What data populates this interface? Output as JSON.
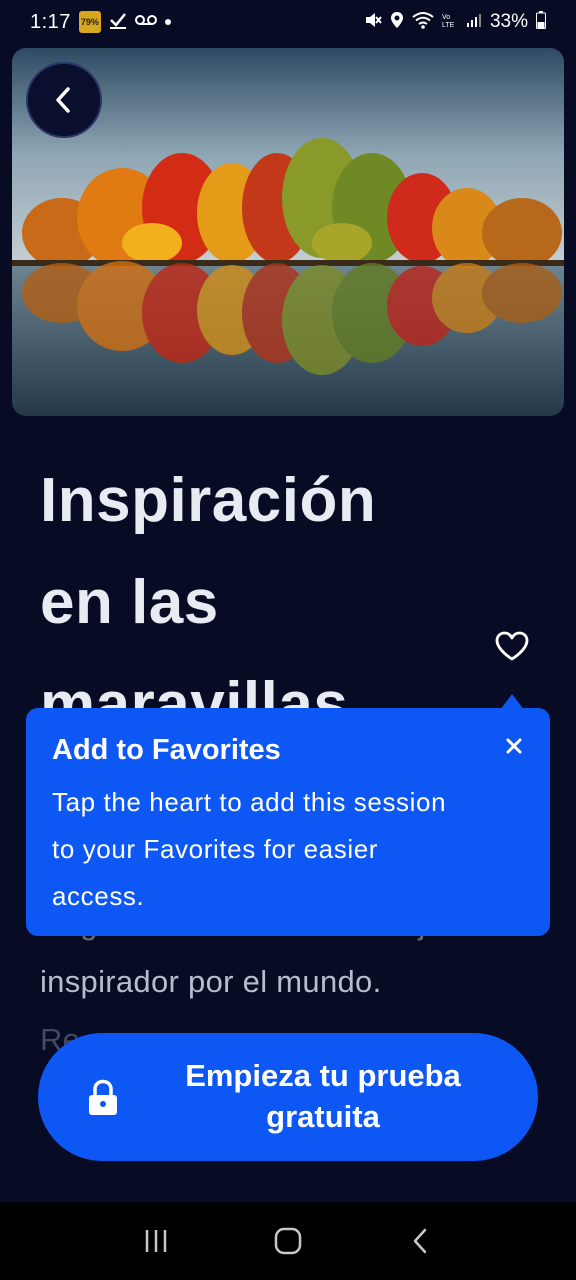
{
  "status_bar": {
    "time": "1:17",
    "badge_text": "79%",
    "battery": "33%",
    "icons_left": [
      "notification-badge-icon",
      "checkmark-download-icon",
      "voicemail-icon",
      "dot-icon"
    ],
    "icons_right": [
      "mute-icon",
      "location-icon",
      "wifi-icon",
      "lte-icon",
      "signal-icon",
      "battery-icon"
    ]
  },
  "hero": {
    "image": "autumn-trees-lake-reflection",
    "back_icon": "chevron-left-icon"
  },
  "content": {
    "title_lines": [
      "Inspiración",
      "en las",
      "maravillas"
    ],
    "desc_hidden": "Regálate a tu mente un viaje",
    "desc_line_1": "inspirador por el mundo.",
    "desc_line_2": "Re"
  },
  "favorite": {
    "icon": "heart-outline-icon"
  },
  "tooltip": {
    "title": "Add to Favorites",
    "body": "Tap the heart to add this session to your Favorites for easier access.",
    "close_icon": "close-icon",
    "color": "#0d58f4"
  },
  "cta": {
    "label_line_1": "Empieza tu prueba",
    "label_line_2": "gratuita",
    "icon": "lock-icon",
    "color": "#0d58f4"
  },
  "nav_bar": {
    "items": [
      "recent-apps-icon",
      "home-icon",
      "back-icon"
    ]
  },
  "colors": {
    "background": "#070b24",
    "accent": "#0d58f4"
  }
}
